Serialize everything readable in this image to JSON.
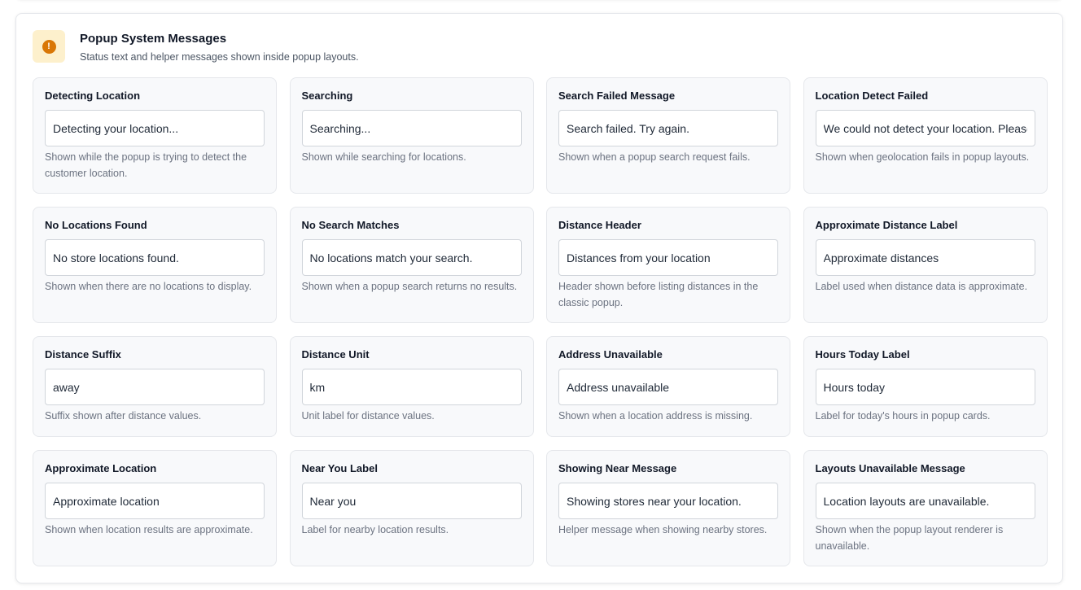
{
  "section": {
    "title": "Popup System Messages",
    "subtitle": "Status text and helper messages shown inside popup layouts.",
    "icon": "exclamation-circle-icon",
    "icon_glyph": "!",
    "accent_color": "#d97706",
    "badge_bg": "#fdf0cc"
  },
  "fields": [
    {
      "label": "Detecting Location",
      "value": "Detecting your location...",
      "help": "Shown while the popup is trying to detect the customer location."
    },
    {
      "label": "Searching",
      "value": "Searching...",
      "help": "Shown while searching for locations."
    },
    {
      "label": "Search Failed Message",
      "value": "Search failed. Try again.",
      "help": "Shown when a popup search request fails."
    },
    {
      "label": "Location Detect Failed",
      "value": "We could not detect your location. Please",
      "help": "Shown when geolocation fails in popup layouts."
    },
    {
      "label": "No Locations Found",
      "value": "No store locations found.",
      "help": "Shown when there are no locations to display."
    },
    {
      "label": "No Search Matches",
      "value": "No locations match your search.",
      "help": "Shown when a popup search returns no results."
    },
    {
      "label": "Distance Header",
      "value": "Distances from your location",
      "help": "Header shown before listing distances in the classic popup."
    },
    {
      "label": "Approximate Distance Label",
      "value": "Approximate distances",
      "help": "Label used when distance data is approximate."
    },
    {
      "label": "Distance Suffix",
      "value": "away",
      "help": "Suffix shown after distance values."
    },
    {
      "label": "Distance Unit",
      "value": "km",
      "help": "Unit label for distance values."
    },
    {
      "label": "Address Unavailable",
      "value": "Address unavailable",
      "help": "Shown when a location address is missing."
    },
    {
      "label": "Hours Today Label",
      "value": "Hours today",
      "help": "Label for today's hours in popup cards."
    },
    {
      "label": "Approximate Location",
      "value": "Approximate location",
      "help": "Shown when location results are approximate."
    },
    {
      "label": "Near You Label",
      "value": "Near you",
      "help": "Label for nearby location results."
    },
    {
      "label": "Showing Near Message",
      "value": "Showing stores near your location.",
      "help": "Helper message when showing nearby stores."
    },
    {
      "label": "Layouts Unavailable Message",
      "value": "Location layouts are unavailable.",
      "help": "Shown when the popup layout renderer is unavailable."
    }
  ]
}
